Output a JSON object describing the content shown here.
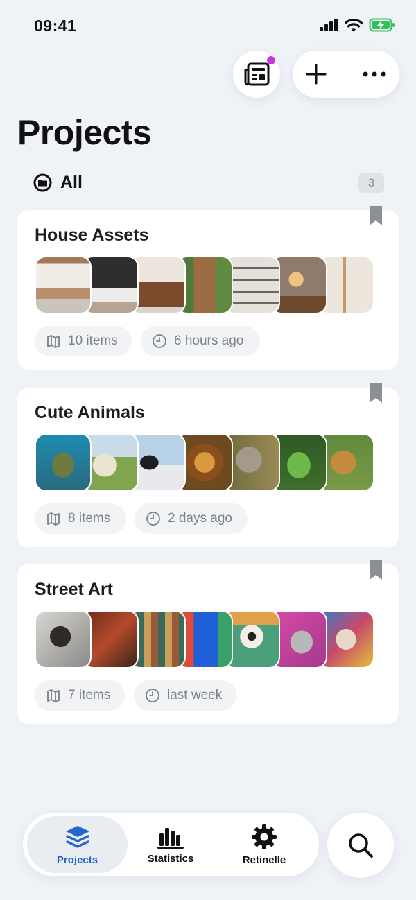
{
  "status_bar": {
    "time": "09:41"
  },
  "page": {
    "title": "Projects"
  },
  "filter": {
    "label": "All",
    "count": "3"
  },
  "projects": [
    {
      "title": "House Assets",
      "items": "10 items",
      "updated": "6 hours ago",
      "thumb_colors": [
        "#c9a888",
        "#3a3a3a",
        "#b89a7c",
        "#5c8a4a",
        "#d8d5d0",
        "#b8865a",
        "#e6e1d9"
      ]
    },
    {
      "title": "Cute Animals",
      "items": "8 items",
      "updated": "2 days ago",
      "thumb_colors": [
        "#2a8fa8",
        "#9bb97a",
        "#a9c6d8",
        "#b57a2c",
        "#7c7044",
        "#3f7a2e",
        "#b68944"
      ]
    },
    {
      "title": "Street Art",
      "items": "7 items",
      "updated": "last week",
      "thumb_colors": [
        "#8e8c8a",
        "#8a3a2a",
        "#6a5a48",
        "#2a5bd0",
        "#4aa07a",
        "#cc4ca8",
        "#6c8fc0"
      ]
    }
  ],
  "tabbar": {
    "tabs": [
      {
        "label": "Projects",
        "icon": "layers-icon",
        "active": true
      },
      {
        "label": "Statistics",
        "icon": "bar-chart-icon",
        "active": false
      },
      {
        "label": "Retinelle",
        "icon": "gear-icon",
        "active": false
      }
    ]
  },
  "colors": {
    "accent": "#2466c9",
    "background": "#eff2f7",
    "notification": "#cc33e0",
    "battery": "#35c15a"
  }
}
